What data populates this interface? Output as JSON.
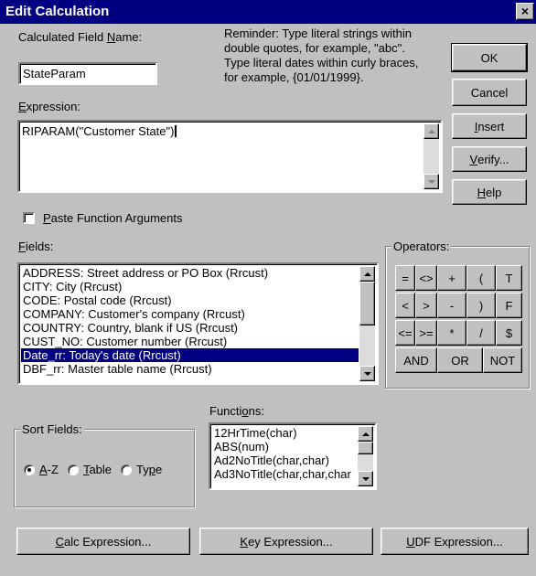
{
  "window": {
    "title": "Edit Calculation",
    "close_glyph": "×"
  },
  "calc_field": {
    "label_pre": "Calculated Field ",
    "label_u": "N",
    "label_post": "ame:",
    "value": "StateParam"
  },
  "reminder": [
    "Reminder: Type literal strings within",
    "double quotes, for example, \"abc\".",
    "Type literal dates within curly braces,",
    "for example, {01/01/1999}."
  ],
  "expression": {
    "label_u": "E",
    "label_post": "xpression:",
    "value": "RIPARAM(\"Customer State\")"
  },
  "buttons": {
    "ok": "OK",
    "cancel": "Cancel",
    "insert_u": "I",
    "insert_post": "nsert",
    "verify_u": "V",
    "verify_post": "erify...",
    "help_u": "H",
    "help_post": "elp"
  },
  "paste_args": {
    "label_u": "P",
    "label_post": "aste Function Arguments",
    "checked": false
  },
  "fields": {
    "label_u": "F",
    "label_post": "ields:",
    "items": [
      "ADDRESS: Street address or PO Box (Rrcust)",
      "CITY: City (Rrcust)",
      "CODE: Postal code (Rrcust)",
      "COMPANY: Customer's company (Rrcust)",
      "COUNTRY: Country, blank if US (Rrcust)",
      "CUST_NO: Customer number (Rrcust)",
      "Date_rr: Today's date (Rrcust)",
      "DBF_rr: Master table name (Rrcust)"
    ],
    "selected_index": 6
  },
  "operators": {
    "title": "Operators:",
    "row1": [
      "=",
      "<>",
      "+",
      "(",
      "T"
    ],
    "row2": [
      "<",
      ">",
      "-",
      ")",
      "F"
    ],
    "row3": [
      "<=",
      ">=",
      "*",
      "/",
      "$"
    ],
    "row4": [
      "AND",
      "OR",
      "NOT"
    ]
  },
  "sort_fields": {
    "title": "Sort Fields:",
    "az_u": "A",
    "az_post": "-Z",
    "table_u": "T",
    "table_post": "able",
    "type_pre": "Ty",
    "type_u": "p",
    "type_post": "e",
    "selected": "A-Z"
  },
  "functions": {
    "label_pre": "Functi",
    "label_u": "o",
    "label_post": "ns:",
    "items": [
      "12HrTime(char)",
      "ABS(num)",
      "Ad2NoTitle(char,char)",
      "Ad3NoTitle(char,char,char"
    ]
  },
  "bottom_buttons": {
    "calc_u": "C",
    "calc_post": "alc Expression...",
    "key_u": "K",
    "key_post": "ey Expression...",
    "udf_u": "U",
    "udf_post": "DF Expression..."
  }
}
